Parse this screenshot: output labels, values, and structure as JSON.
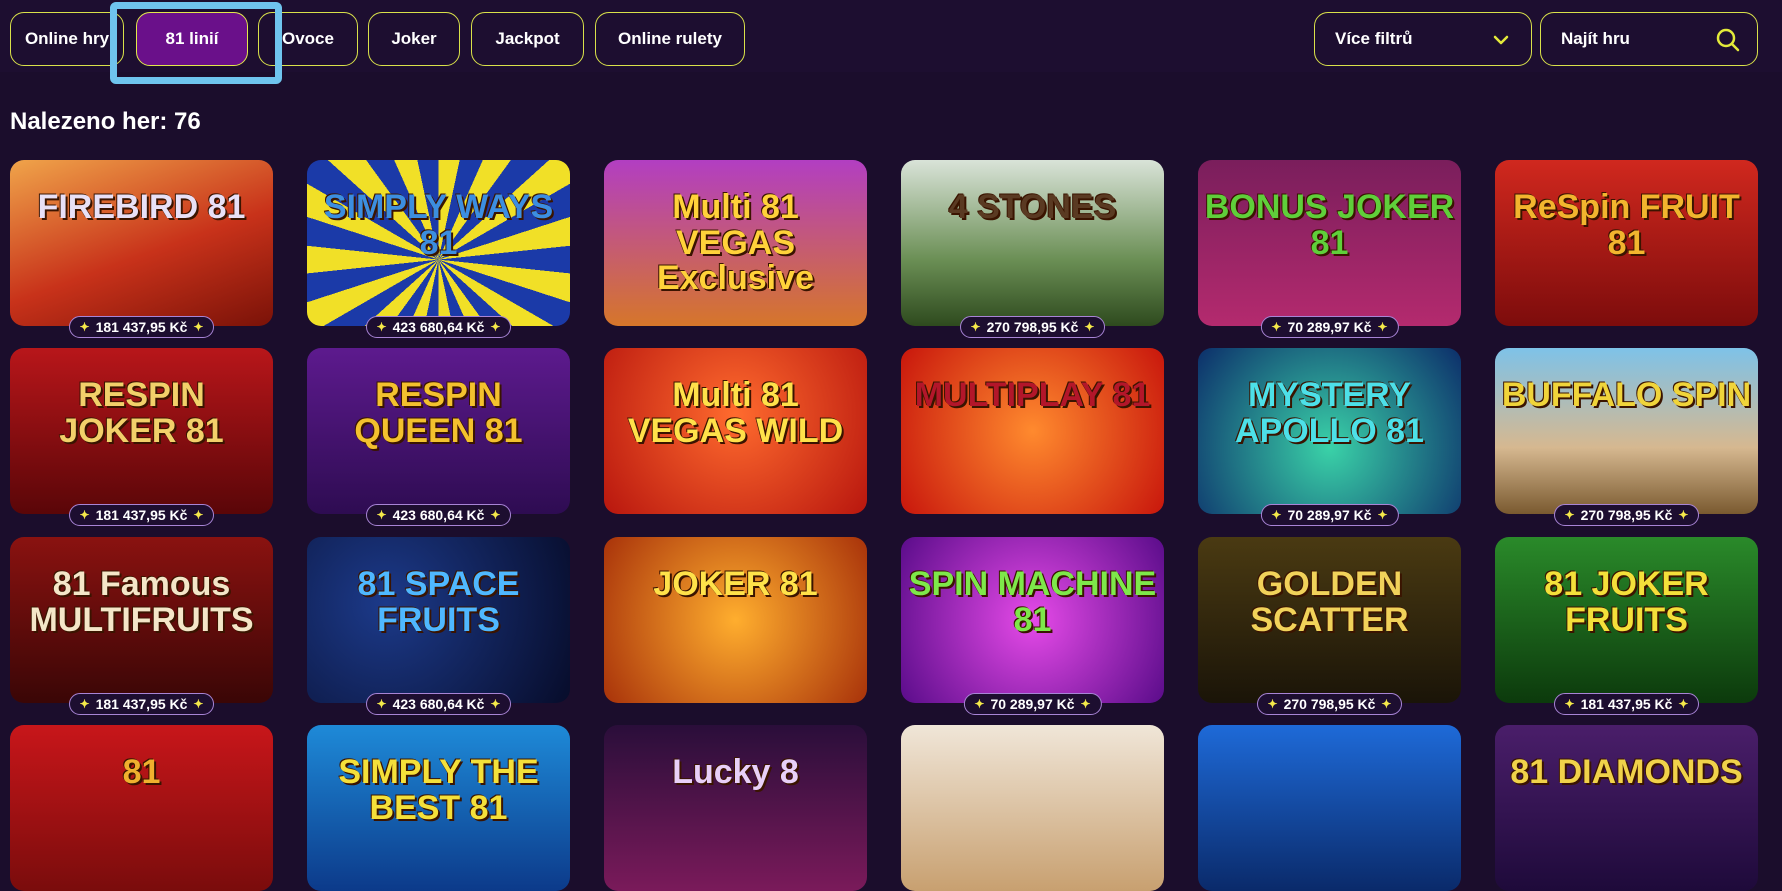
{
  "tabs": [
    {
      "label": "Online hry",
      "active": false
    },
    {
      "label": "81 linií",
      "active": true
    },
    {
      "label": "Ovoce",
      "active": false
    },
    {
      "label": "Joker",
      "active": false
    },
    {
      "label": "Jackpot",
      "active": false
    },
    {
      "label": "Online rulety",
      "active": false
    }
  ],
  "filters": {
    "label": "Více filtrů",
    "icon": "chevron-down-icon"
  },
  "search": {
    "placeholder": "Najít hru",
    "icon": "search-icon"
  },
  "results": {
    "label": "Nalezeno her: 76"
  },
  "colors": {
    "accent": "#d9e14a",
    "active_tab": "#6a108a",
    "background": "#1b0d2c",
    "highlight": "#6fc4ee"
  },
  "games": [
    {
      "title": "FIREBIRD 81",
      "jackpot": "181 437,95 Kč",
      "bg": "linear-gradient(160deg,#f0a44a,#c8321a 55%,#7a1208)",
      "color": "#e8e0f6"
    },
    {
      "title": "SIMPLY WAYS 81",
      "jackpot": "423 680,64 Kč",
      "bg": "repeating-conic-gradient(from 0deg at 50% 60%,#f1e027 0 12deg,#1b3aa8 12deg 24deg)",
      "color": "#3c8ee0"
    },
    {
      "title": "Multi 81 VEGAS Exclusive",
      "jackpot": "",
      "bg": "linear-gradient(180deg,#b23ec2,#d6762a)",
      "color": "#ffd23a"
    },
    {
      "title": "4 STONES",
      "jackpot": "270 798,95 Kč",
      "bg": "linear-gradient(180deg,#d9e3d8,#6b8f55 60%,#2e4a1e)",
      "color": "#5a3a22"
    },
    {
      "title": "BONUS JOKER 81",
      "jackpot": "70 289,97 Kč",
      "bg": "linear-gradient(180deg,#7a1e5c,#b42a6e)",
      "color": "#5fcf3a"
    },
    {
      "title": "ReSpin FRUIT 81",
      "jackpot": "",
      "bg": "linear-gradient(180deg,#d0281e,#7d0c0c)",
      "color": "#f2b52e"
    },
    {
      "title": "RESPIN JOKER 81",
      "jackpot": "181 437,95 Kč",
      "bg": "linear-gradient(180deg,#b8161a,#5a0608)",
      "color": "#f2d06a"
    },
    {
      "title": "RESPIN QUEEN 81",
      "jackpot": "423 680,64 Kč",
      "bg": "linear-gradient(180deg,#5d1a8e,#2e0c52)",
      "color": "#f3c12e"
    },
    {
      "title": "Multi 81 VEGAS WILD",
      "jackpot": "",
      "bg": "radial-gradient(circle at 50% 40%,#ff6b2e,#b8160e)",
      "color": "#ffe14a"
    },
    {
      "title": "MULTIPLAY 81",
      "jackpot": "",
      "bg": "radial-gradient(circle at 50% 50%,#ff8a2e,#c8160c)",
      "color": "#b3162a"
    },
    {
      "title": "MYSTERY APOLLO 81",
      "jackpot": "70 289,97 Kč",
      "bg": "radial-gradient(circle at 50% 60%,#3ad2a8,#0c2e6a)",
      "color": "#4de0e8"
    },
    {
      "title": "BUFFALO SPIN",
      "jackpot": "270 798,95 Kč",
      "bg": "linear-gradient(180deg,#7ec2e8,#d6b890 60%,#7a5a30)",
      "color": "#f0d43a"
    },
    {
      "title": "81 Famous MULTIFRUITS",
      "jackpot": "181 437,95 Kč",
      "bg": "linear-gradient(180deg,#8a1210,#3a0606)",
      "color": "#f4e6c8"
    },
    {
      "title": "81 SPACE FRUITS",
      "jackpot": "423 680,64 Kč",
      "bg": "radial-gradient(circle at 30% 40%,#1c3a8a,#070c2a)",
      "color": "#4fb8ff"
    },
    {
      "title": "JOKER 81",
      "jackpot": "",
      "bg": "radial-gradient(circle at 50% 50%,#ffae2e,#a8320a)",
      "color": "#ffe24a"
    },
    {
      "title": "SPIN MACHINE 81",
      "jackpot": "70 289,97 Kč",
      "bg": "radial-gradient(circle at 50% 50%,#e64ae8,#5a0c8a)",
      "color": "#7ee84a"
    },
    {
      "title": "GOLDEN SCATTER",
      "jackpot": "270 798,95 Kč",
      "bg": "linear-gradient(180deg,#4a3a12,#1a1408)",
      "color": "#f1d25a"
    },
    {
      "title": "81 JOKER FRUITS",
      "jackpot": "181 437,95 Kč",
      "bg": "linear-gradient(180deg,#2a8a2a,#0c3a0c)",
      "color": "#f4e03a"
    },
    {
      "title": "81",
      "jackpot": "",
      "bg": "linear-gradient(180deg,#c8161a,#7a0c0c)",
      "color": "#f0b02e"
    },
    {
      "title": "SIMPLY THE BEST 81",
      "jackpot": "",
      "bg": "linear-gradient(180deg,#1e8ad8,#0c3a8a)",
      "color": "#f4e03a"
    },
    {
      "title": "Lucky 8",
      "jackpot": "",
      "bg": "linear-gradient(180deg,#2a0e3a,#7a1a5a)",
      "color": "#e8d0f8"
    },
    {
      "title": "",
      "jackpot": "",
      "bg": "linear-gradient(180deg,#f0e6d8,#c8a070)",
      "color": "#5a3a22"
    },
    {
      "title": "",
      "jackpot": "",
      "bg": "linear-gradient(180deg,#1e6ad8,#0a2a6a)",
      "color": "#ff3a3a"
    },
    {
      "title": "81 DIAMONDS",
      "jackpot": "",
      "bg": "linear-gradient(180deg,#4a1e6a,#1e0a3a)",
      "color": "#f0d24a"
    }
  ]
}
